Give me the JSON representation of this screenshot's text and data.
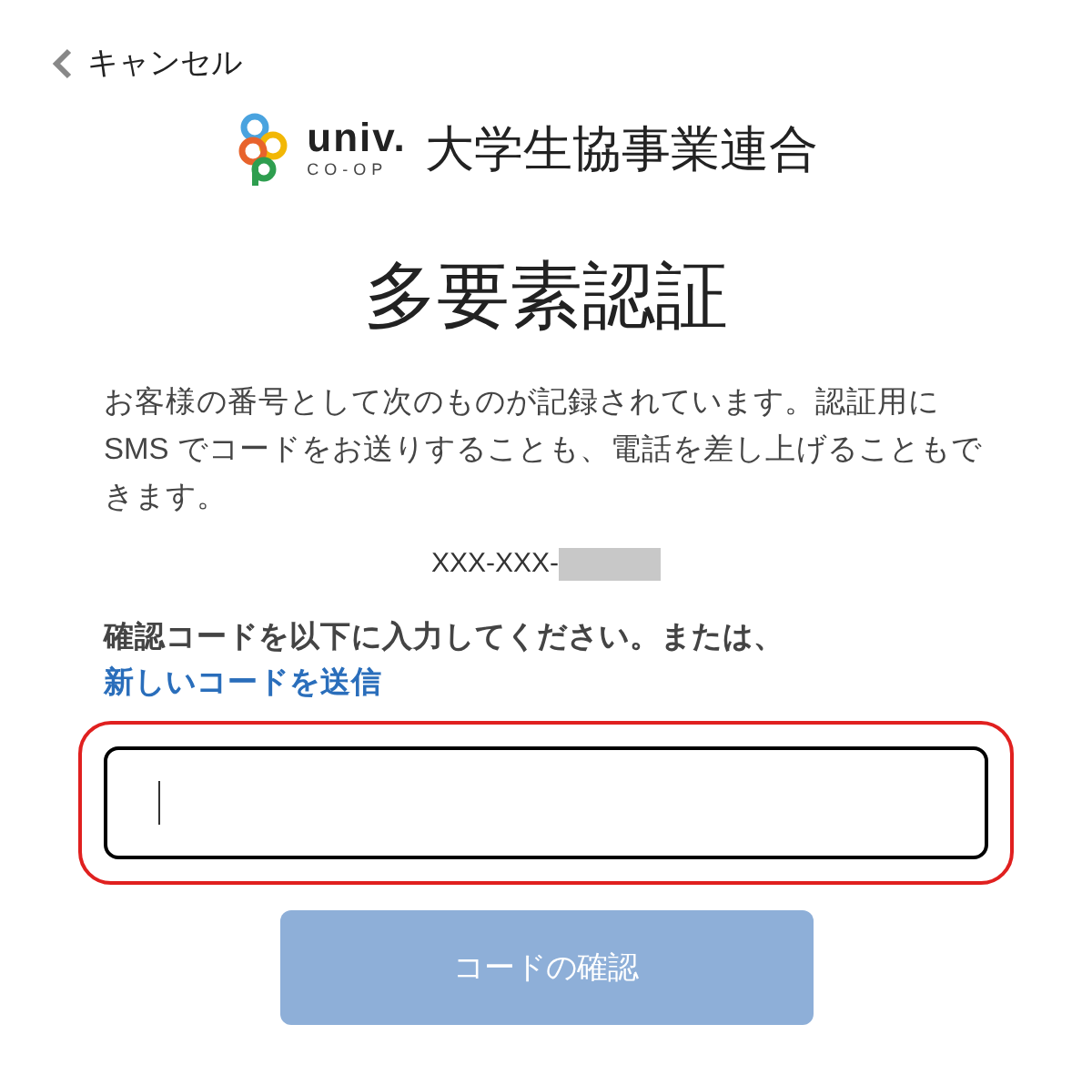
{
  "cancel": {
    "label": "キャンセル"
  },
  "logo": {
    "mark_top": "univ.",
    "mark_bottom": "CO-OP",
    "name": "大学生協事業連合"
  },
  "title": "多要素認証",
  "description": "お客様の番号として次のものが記録されています。認証用に SMS でコードをお送りすることも、電話を差し上げることもできます。",
  "phone": {
    "prefix": "XXX-XXX-",
    "redacted": true
  },
  "instruction": {
    "text": "確認コードを以下に入力してください。または、",
    "link": "新しいコードを送信"
  },
  "code_field": {
    "focused": true,
    "highlighted": true
  },
  "verify_button": {
    "label": "コードの確認",
    "disabled": true
  }
}
